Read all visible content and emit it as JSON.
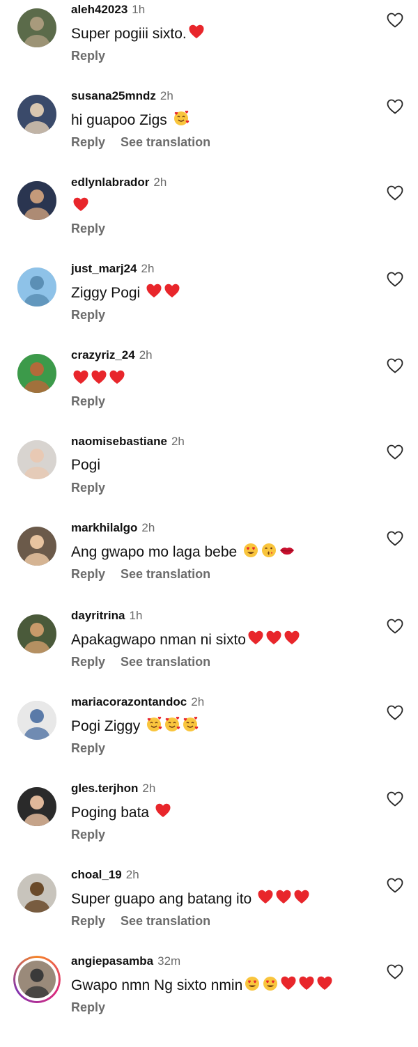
{
  "reply_label": "Reply",
  "translate_label": "See translation",
  "comments": [
    {
      "username": "aleh42023",
      "time": "1h",
      "text": "Super pogiii sixto.",
      "emojis": [
        "heart"
      ],
      "translatable": false,
      "avatar_colors": [
        "#5b6b4a",
        "#a89a7c"
      ]
    },
    {
      "username": "susana25mndz",
      "time": "2h",
      "text": "hi guapoo Zigs ",
      "emojis": [
        "smiling-hearts"
      ],
      "translatable": true,
      "avatar_colors": [
        "#3a4a6a",
        "#d9c7b0"
      ]
    },
    {
      "username": "edlynlabrador",
      "time": "2h",
      "text": "",
      "emojis": [
        "heart"
      ],
      "translatable": false,
      "avatar_colors": [
        "#2a3550",
        "#c49a7a"
      ]
    },
    {
      "username": "just_marj24",
      "time": "2h",
      "text": "Ziggy Pogi ",
      "emojis": [
        "heart",
        "heart"
      ],
      "translatable": false,
      "avatar_colors": [
        "#8ec2e8",
        "#5b8fb5"
      ]
    },
    {
      "username": "crazyriz_24",
      "time": "2h",
      "text": "",
      "emojis": [
        "heart",
        "heart",
        "heart"
      ],
      "translatable": false,
      "avatar_colors": [
        "#3c9a4a",
        "#b36a3a"
      ]
    },
    {
      "username": "naomisebastiane",
      "time": "2h",
      "text": "Pogi",
      "emojis": [],
      "translatable": false,
      "avatar_colors": [
        "#d8d4d0",
        "#e8c9b4"
      ]
    },
    {
      "username": "markhilalgo",
      "time": "2h",
      "text": "Ang gwapo mo laga bebe ",
      "emojis": [
        "heart-eyes",
        "kiss",
        "lips"
      ],
      "translatable": true,
      "avatar_colors": [
        "#6b5a4a",
        "#e8c4a0"
      ]
    },
    {
      "username": "dayritrina",
      "time": "1h",
      "text": "Apakagwapo  nman ni sixto",
      "emojis": [
        "heart",
        "heart",
        "heart"
      ],
      "translatable": true,
      "avatar_colors": [
        "#4a5a3a",
        "#c89a6a"
      ]
    },
    {
      "username": "mariacorazontandoc",
      "time": "2h",
      "text": "Pogi Ziggy ",
      "emojis": [
        "smiling-hearts",
        "smiling-hearts",
        "smiling-hearts"
      ],
      "translatable": false,
      "avatar_colors": [
        "#e8e8e8",
        "#5a7aa8"
      ]
    },
    {
      "username": "gles.terjhon",
      "time": "2h",
      "text": "Poging bata ",
      "emojis": [
        "heart"
      ],
      "translatable": false,
      "avatar_colors": [
        "#2a2a2a",
        "#e0b89a"
      ]
    },
    {
      "username": "choal_19",
      "time": "2h",
      "text": "Super guapo ang batang ito ",
      "emojis": [
        "heart",
        "heart",
        "heart"
      ],
      "translatable": true,
      "avatar_colors": [
        "#c8c4bc",
        "#6a4a2a"
      ]
    },
    {
      "username": "angiepasamba",
      "time": "32m",
      "text": "Gwapo nmn Ng sixto nmin",
      "emojis": [
        "heart-eyes",
        "heart-eyes",
        "heart",
        "heart",
        "heart"
      ],
      "translatable": false,
      "avatar_colors": [
        "#9a8a7a",
        "#3a3a3a"
      ],
      "story": true
    }
  ]
}
